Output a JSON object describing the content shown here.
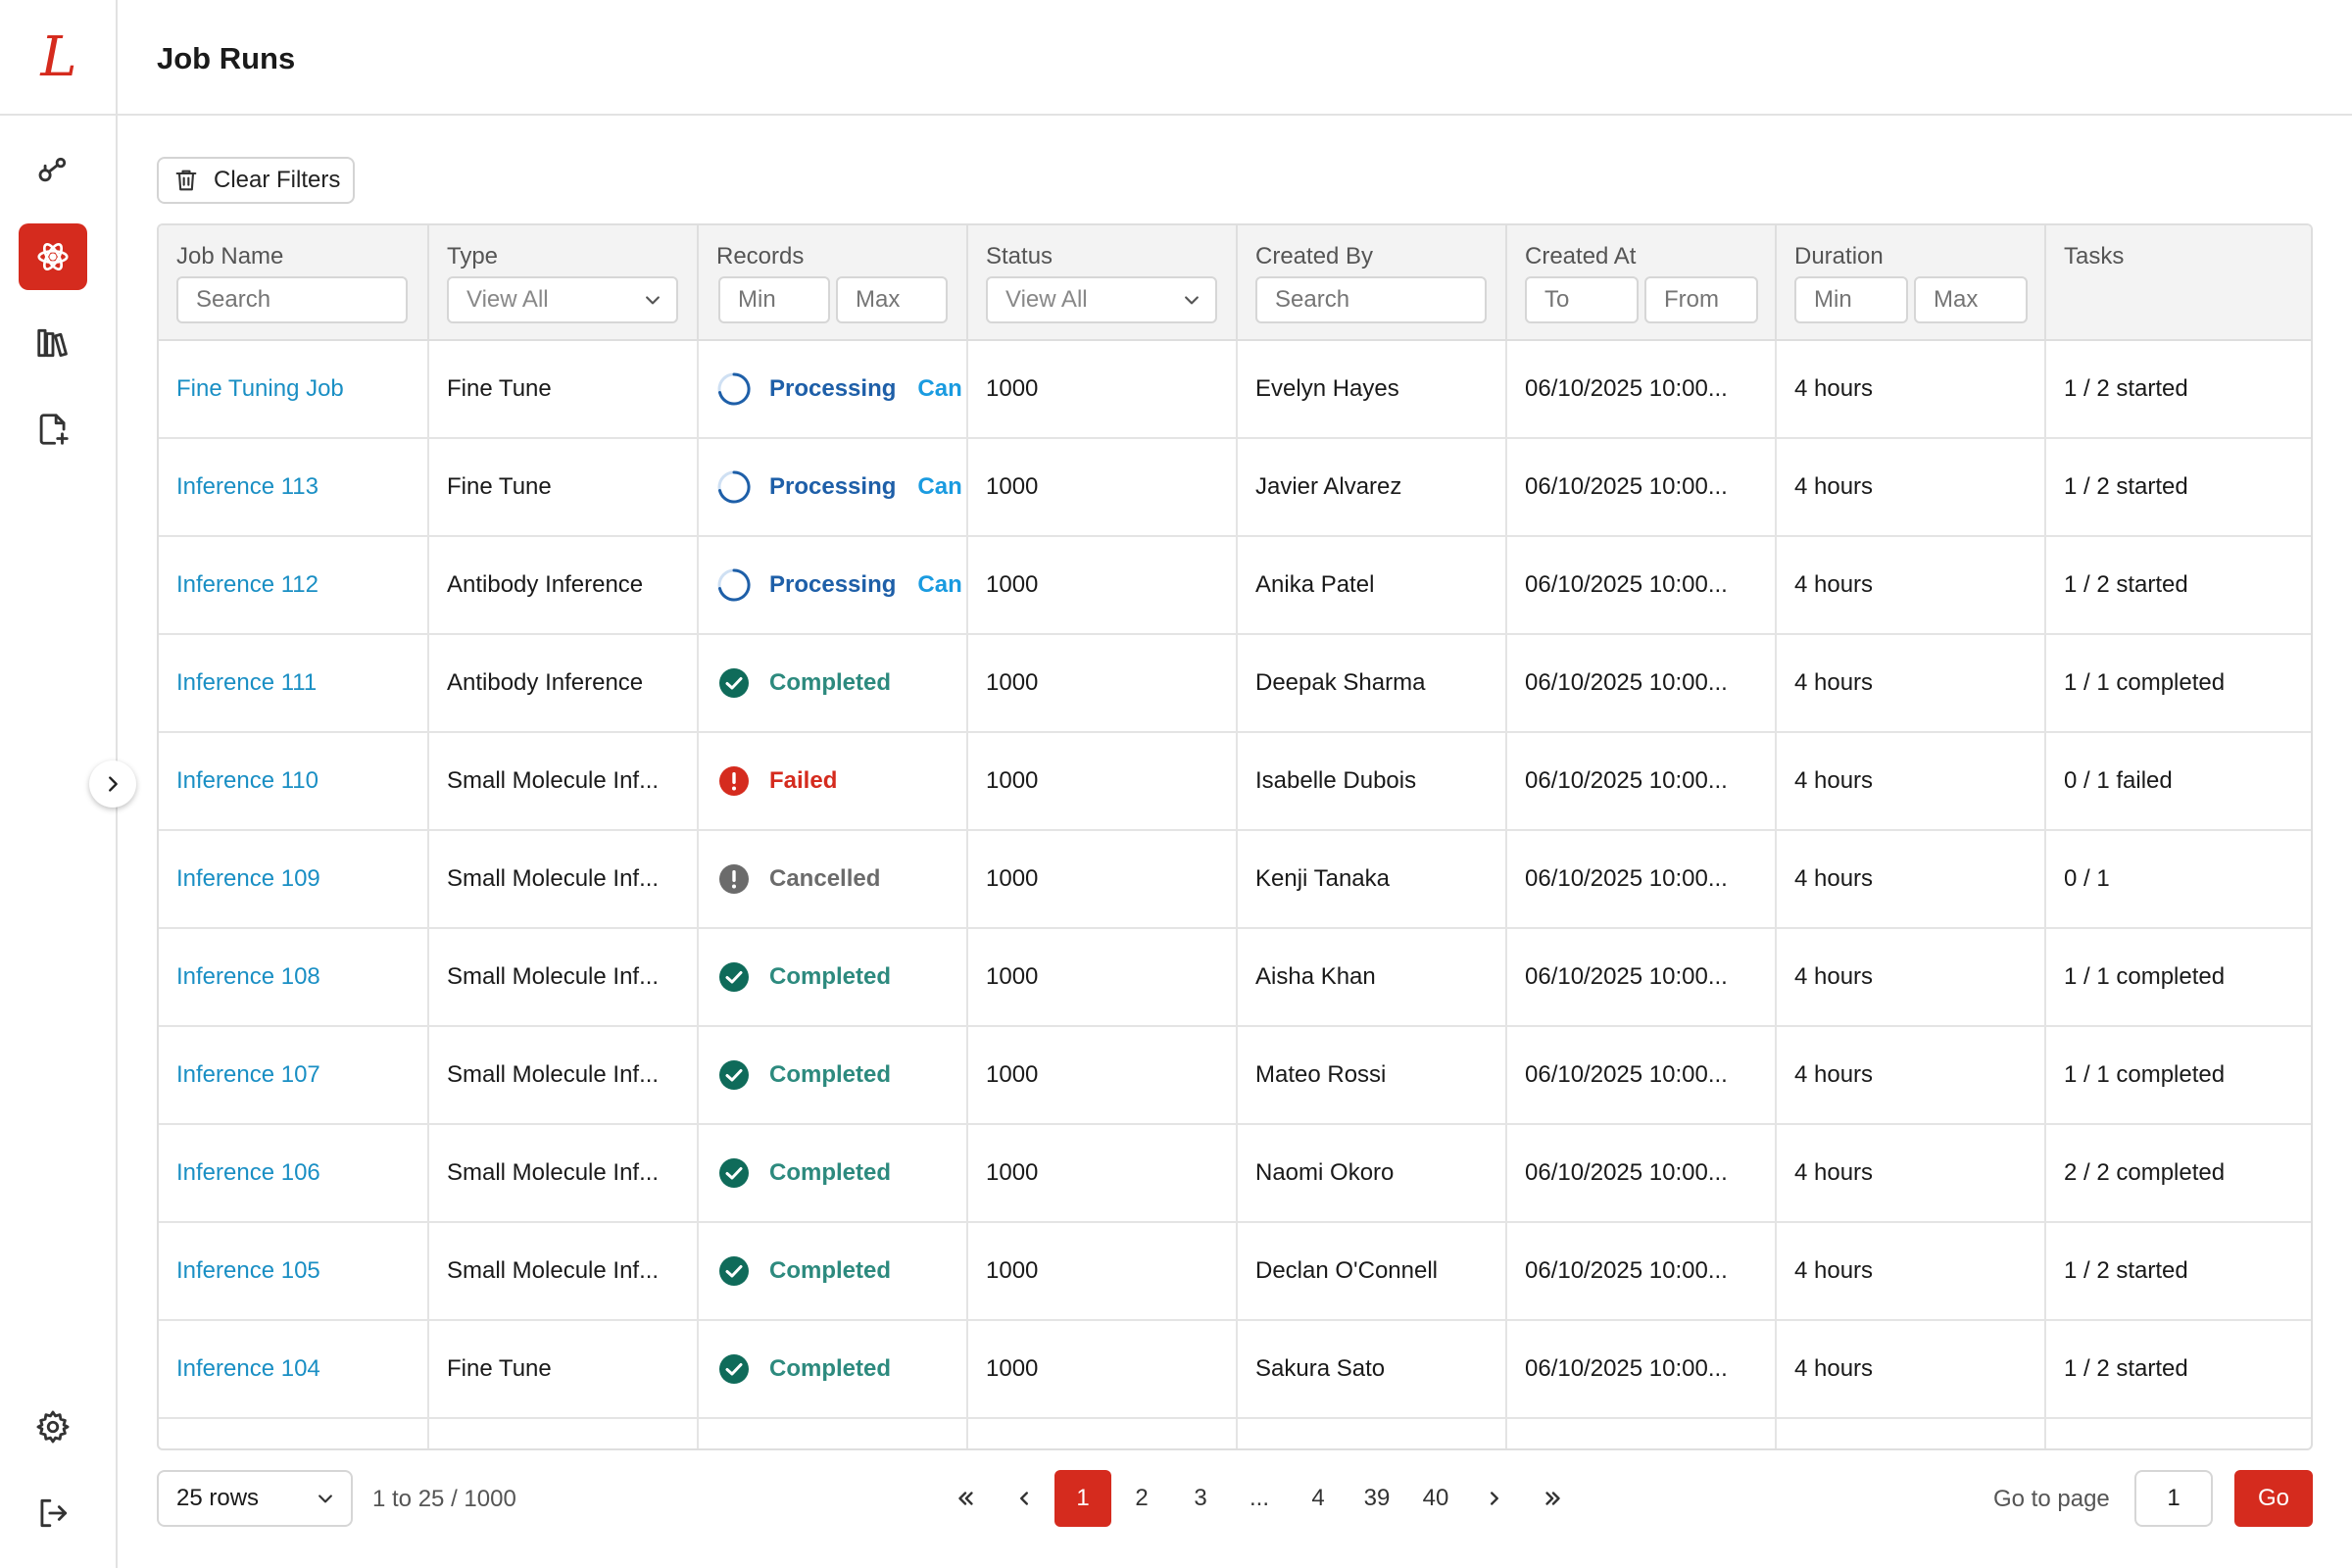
{
  "app": {
    "logo_text": "L",
    "title": "Job Runs"
  },
  "sidebar": {
    "items": [
      {
        "icon": "workflow-icon",
        "active": false
      },
      {
        "icon": "atom-icon",
        "active": true
      },
      {
        "icon": "library-icon",
        "active": false
      },
      {
        "icon": "add-file-icon",
        "active": false
      }
    ],
    "bottom": [
      {
        "icon": "gear-icon"
      },
      {
        "icon": "logout-icon"
      }
    ]
  },
  "toolbar": {
    "clear_filters_label": "Clear Filters"
  },
  "table": {
    "columns": [
      {
        "label": "Job Name",
        "filters": [
          {
            "kind": "input",
            "placeholder": "Search"
          }
        ]
      },
      {
        "label": "Type",
        "filters": [
          {
            "kind": "select",
            "value": "View All"
          }
        ]
      },
      {
        "label": "Records",
        "filters": [
          {
            "kind": "input",
            "placeholder": "Min"
          },
          {
            "kind": "input",
            "placeholder": "Max"
          }
        ]
      },
      {
        "label": "Status",
        "filters": [
          {
            "kind": "select",
            "value": "View All"
          }
        ]
      },
      {
        "label": "Created By",
        "filters": [
          {
            "kind": "input",
            "placeholder": "Search"
          }
        ]
      },
      {
        "label": "Created At",
        "filters": [
          {
            "kind": "input",
            "placeholder": "To"
          },
          {
            "kind": "input",
            "placeholder": "From"
          }
        ]
      },
      {
        "label": "Duration",
        "filters": [
          {
            "kind": "input",
            "placeholder": "Min"
          },
          {
            "kind": "input",
            "placeholder": "Max"
          }
        ]
      },
      {
        "label": "Tasks",
        "filters": []
      }
    ],
    "rows": [
      {
        "job_name": "Fine Tuning Job",
        "type": "Fine Tune",
        "status": "Processing",
        "status_kind": "processing",
        "action": "Can",
        "records": "1000",
        "created_by": "Evelyn Hayes",
        "created_at": "06/10/2025 10:00...",
        "duration": "4 hours",
        "tasks": "1 / 2 started"
      },
      {
        "job_name": "Inference 113",
        "type": "Fine Tune",
        "status": "Processing",
        "status_kind": "processing",
        "action": "Can",
        "records": "1000",
        "created_by": "Javier Alvarez",
        "created_at": "06/10/2025 10:00...",
        "duration": "4 hours",
        "tasks": "1 / 2 started"
      },
      {
        "job_name": "Inference 112",
        "type": "Antibody Inference",
        "status": "Processing",
        "status_kind": "processing",
        "action": "Can",
        "records": "1000",
        "created_by": "Anika Patel",
        "created_at": "06/10/2025 10:00...",
        "duration": "4 hours",
        "tasks": "1 / 2 started"
      },
      {
        "job_name": "Inference 111",
        "type": "Antibody Inference",
        "status": "Completed",
        "status_kind": "completed",
        "action": "",
        "records": "1000",
        "created_by": "Deepak Sharma",
        "created_at": "06/10/2025 10:00...",
        "duration": "4 hours",
        "tasks": "1 / 1 completed"
      },
      {
        "job_name": "Inference 110",
        "type": "Small Molecule Inf...",
        "status": "Failed",
        "status_kind": "failed",
        "action": "",
        "records": "1000",
        "created_by": "Isabelle Dubois",
        "created_at": "06/10/2025 10:00...",
        "duration": "4 hours",
        "tasks": "0 / 1 failed"
      },
      {
        "job_name": "Inference 109",
        "type": "Small Molecule Inf...",
        "status": "Cancelled",
        "status_kind": "cancelled",
        "action": "",
        "records": "1000",
        "created_by": "Kenji Tanaka",
        "created_at": "06/10/2025 10:00...",
        "duration": "4 hours",
        "tasks": "0 / 1"
      },
      {
        "job_name": "Inference 108",
        "type": "Small Molecule Inf...",
        "status": "Completed",
        "status_kind": "completed",
        "action": "",
        "records": "1000",
        "created_by": "Aisha Khan",
        "created_at": "06/10/2025 10:00...",
        "duration": "4 hours",
        "tasks": "1 / 1 completed"
      },
      {
        "job_name": "Inference 107",
        "type": "Small Molecule Inf...",
        "status": "Completed",
        "status_kind": "completed",
        "action": "",
        "records": "1000",
        "created_by": "Mateo Rossi",
        "created_at": "06/10/2025 10:00...",
        "duration": "4 hours",
        "tasks": "1 / 1 completed"
      },
      {
        "job_name": "Inference 106",
        "type": "Small Molecule Inf...",
        "status": "Completed",
        "status_kind": "completed",
        "action": "",
        "records": "1000",
        "created_by": "Naomi Okoro",
        "created_at": "06/10/2025 10:00...",
        "duration": "4 hours",
        "tasks": "2 / 2 completed"
      },
      {
        "job_name": "Inference 105",
        "type": "Small Molecule Inf...",
        "status": "Completed",
        "status_kind": "completed",
        "action": "",
        "records": "1000",
        "created_by": "Declan O'Connell",
        "created_at": "06/10/2025 10:00...",
        "duration": "4 hours",
        "tasks": "1 / 2 started"
      },
      {
        "job_name": "Inference 104",
        "type": "Fine Tune",
        "status": "Completed",
        "status_kind": "completed",
        "action": "",
        "records": "1000",
        "created_by": "Sakura Sato",
        "created_at": "06/10/2025 10:00...",
        "duration": "4 hours",
        "tasks": "1 / 2 started"
      }
    ]
  },
  "pagination": {
    "rows_per_page": "25 rows",
    "range": "1 to 25 / 1000",
    "pages": [
      "1",
      "2",
      "3",
      "...",
      "4",
      "39",
      "40"
    ],
    "current_page": "1",
    "goto_label": "Go to page",
    "goto_value": "1",
    "go_label": "Go"
  },
  "colors": {
    "accent": "#d52b1e",
    "link": "#1a8fc4",
    "completed": "#2d8a7e",
    "processing": "#1e5fa8",
    "failed": "#d52b1e",
    "cancelled": "#6b6b6b"
  }
}
